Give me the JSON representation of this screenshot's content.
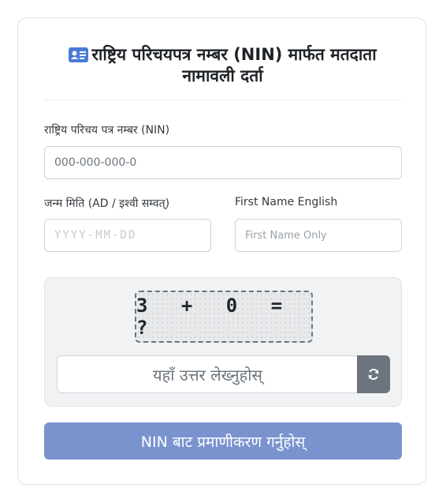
{
  "header": {
    "title_line1": "राष्ट्रिय परिचयपत्र नम्बर (NIN) मार्फत मतदाता",
    "title_line2": "नामावली दर्ता",
    "icon": "id-card-icon",
    "icon_color": "#4a7bd6"
  },
  "form": {
    "nin": {
      "label": "राष्ट्रिय परिचय पत्र नम्बर (NIN)",
      "placeholder": "000-000-000-0"
    },
    "dob": {
      "label": "जन्म मिति (AD / इश्वी सम्वत्)",
      "placeholder": "YYYY-MM-DD"
    },
    "first_name": {
      "label": "First Name English",
      "placeholder": "First Name Only"
    }
  },
  "captcha": {
    "question": "3 + 0 = ?",
    "answer_placeholder": "यहाँ उत्तर लेख्नुहोस्",
    "refresh_icon": "refresh-icon"
  },
  "submit": {
    "label": "NIN बाट प्रमाणीकरण गर्नुहोस्",
    "color": "#7a93cf"
  }
}
